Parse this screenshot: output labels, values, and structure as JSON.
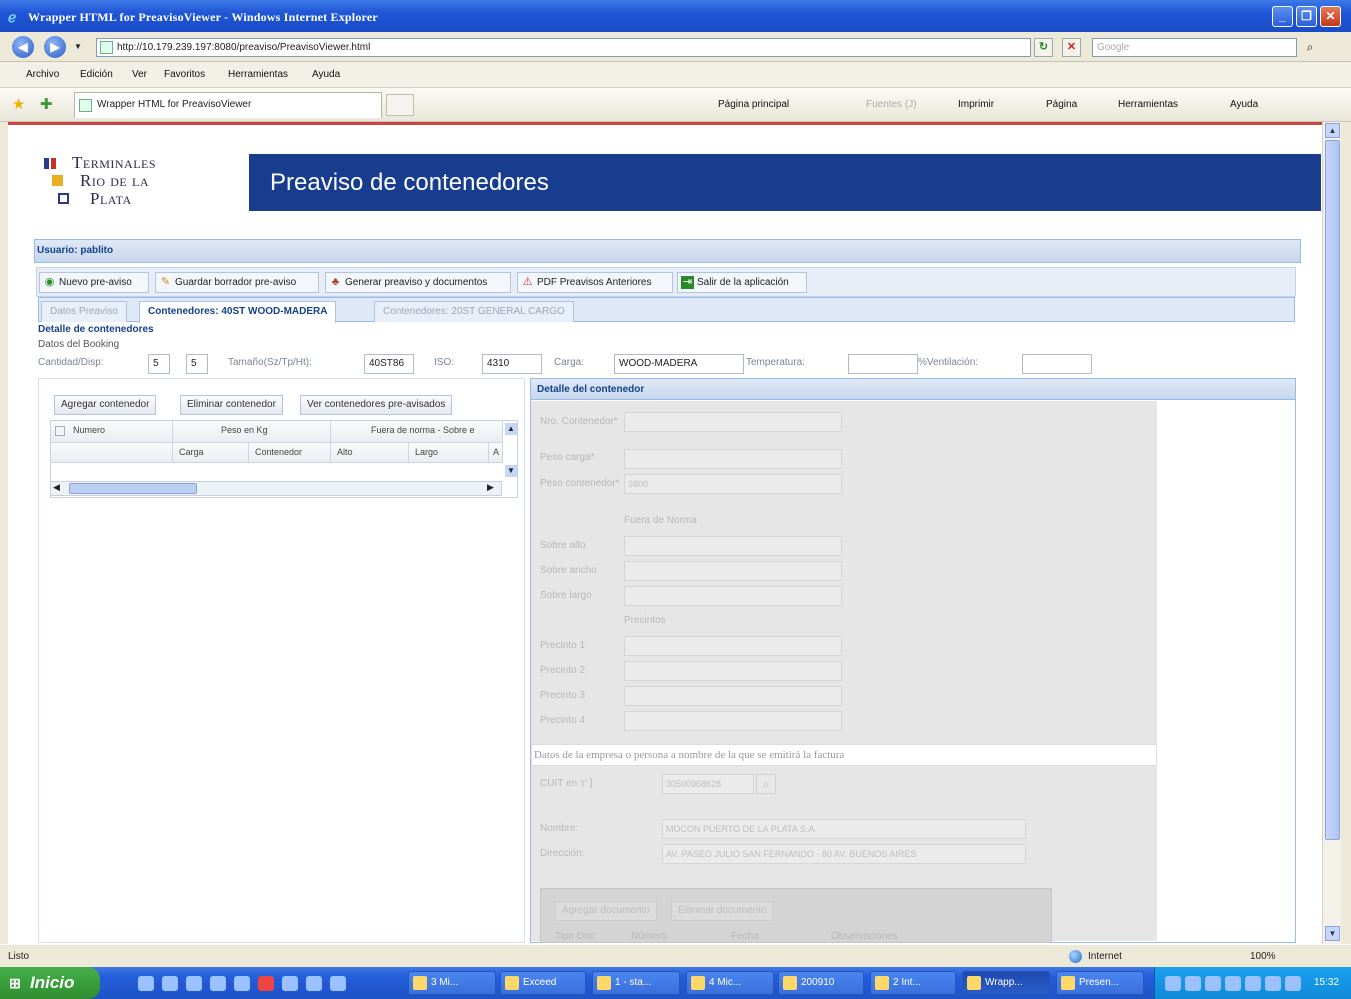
{
  "window": {
    "title": "Wrapper HTML for PreavisoViewer - Windows Internet Explorer",
    "min": "_",
    "max": "❐",
    "close": "✕"
  },
  "browser": {
    "url": "http://10.179.239.197:8080/preaviso/PreavisoViewer.html",
    "search_placeholder": "Google",
    "menu": [
      "Archivo",
      "Edición",
      "Ver",
      "Favoritos",
      "Herramientas",
      "Ayuda"
    ],
    "tab_title": "Wrapper HTML for PreavisoViewer",
    "commands": {
      "home": "Página principal",
      "feeds": "Fuentes (J)",
      "print": "Imprimir",
      "page": "Página",
      "tools": "Herramientas",
      "help": "Ayuda"
    },
    "status": "Listo",
    "zone": "Internet",
    "zoom": "100%"
  },
  "logo": {
    "line1": "Terminales",
    "line2": "Rio de la",
    "line3": "Plata"
  },
  "banner": {
    "title": "Preaviso de contenedores"
  },
  "user": {
    "label": "Usuario: pablito"
  },
  "toolbar": {
    "new": "Nuevo pre-aviso",
    "save": "Guardar borrador pre-aviso",
    "generate": "Generar preaviso y documentos",
    "pdf": "PDF Preavisos Anteriores",
    "exit": "Salir de la aplicación"
  },
  "tabs": [
    {
      "label": "Datos Preaviso"
    },
    {
      "label": "Contenedores: 40ST WOOD-MADERA"
    },
    {
      "label": "Contenedores: 20ST GENERAL CARGO"
    }
  ],
  "detail": {
    "section": "Detalle de contenedores",
    "booking": "Datos del Booking",
    "fields": {
      "cantidad_label": "Cantidad/Disp:",
      "cantidad": "5",
      "disp": "5",
      "tamano_label": "Tamaño(Sz/Tp/Ht):",
      "tamano": "40ST86",
      "iso_label": "ISO:",
      "iso": "4310",
      "carga_label": "Carga:",
      "carga": "WOOD-MADERA",
      "temp_label": "Temperatura:",
      "temp": "",
      "vent_label": "%Ventilación:",
      "vent": ""
    }
  },
  "left": {
    "add": "Agregar contenedor",
    "remove": "Eliminar contenedor",
    "view": "Ver contenedores pre-avisados",
    "grid": {
      "col_numero": "Numero",
      "col_peso": "Peso en Kg",
      "col_fuera": "Fuera de norma - Sobre e",
      "sub_carga": "Carga",
      "sub_contenedor": "Contenedor",
      "sub_alto": "Alto",
      "sub_largo": "Largo",
      "sub_a": "A"
    }
  },
  "right": {
    "header": "Detalle del contenedor",
    "nro": "Nro. Contenedor*",
    "peso_carga": "Peso carga*",
    "peso_cont": "Peso contenedor*",
    "peso_cont_val": "3800",
    "fuera_norma": "Fuera de Norma",
    "sobre_alto": "Sobre alto",
    "sobre_ancho": "Sobre ancho",
    "sobre_largo": "Sobre largo",
    "precintos": "Precintos",
    "precinto1": "Precinto 1",
    "precinto2": "Precinto 2",
    "precinto3": "Precinto 3",
    "precinto4": "Precinto 4",
    "factura": "Datos de la empresa o persona a nombre de la que se emitirá la factura",
    "cuit_label": "CUIT en 'r' ]",
    "cuit": "30500968628",
    "nombre_label": "Nombre:",
    "nombre": "MOCON PUERTO DE LA PLATA S.A.",
    "direccion_label": "Dirección:",
    "direccion": "AV. PASEO JULIO SAN FERNANDO - 80 AV. BUENOS AIRES",
    "sub_add": "Agregar documento",
    "sub_remove": "Eliminar documento",
    "sub_cols": [
      "Tipo Doc",
      "Número",
      "Fecha",
      "Observaciones"
    ]
  },
  "taskbar": {
    "start": "Inicio",
    "items": [
      "3 Mi...",
      "Exceed",
      "1 - sta...",
      "4 Mic...",
      "200910",
      "2 Int...",
      "Wrapp...",
      "Presen..."
    ],
    "clock": "15:32"
  }
}
